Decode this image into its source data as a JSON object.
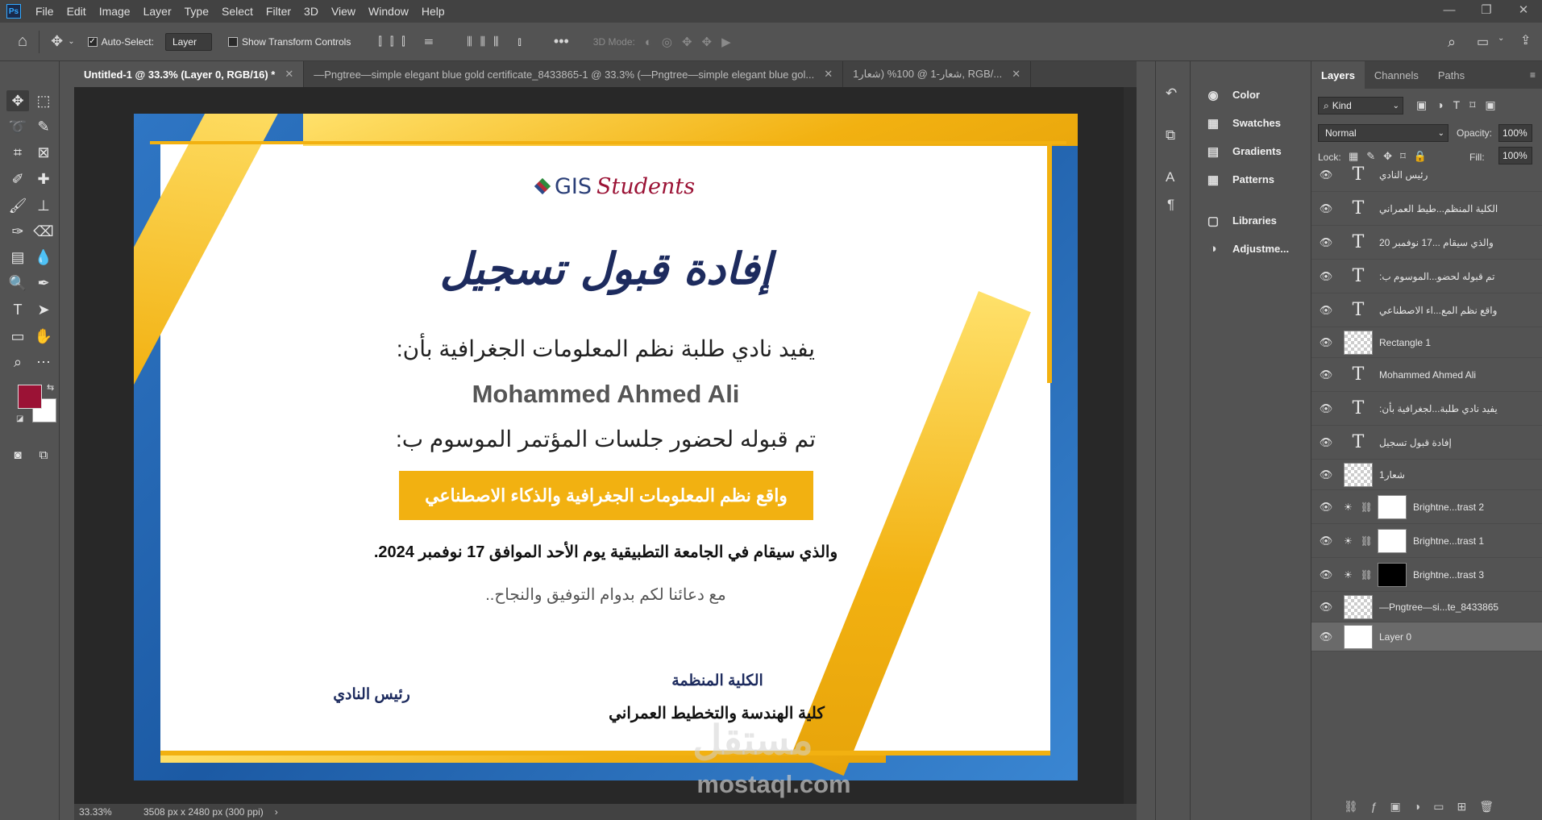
{
  "menubar": {
    "logo": "Ps",
    "items": [
      "File",
      "Edit",
      "Image",
      "Layer",
      "Type",
      "Select",
      "Filter",
      "3D",
      "View",
      "Window",
      "Help"
    ],
    "window_controls": [
      "—",
      "❐",
      "✕"
    ]
  },
  "options": {
    "auto_select_label": "Auto-Select:",
    "auto_select_value": "Layer",
    "transform_label": "Show Transform Controls",
    "mode_3d_label": "3D Mode:"
  },
  "tabs": [
    {
      "label": "Untitled-1 @ 33.3% (Layer 0, RGB/16) *",
      "active": true
    },
    {
      "label": "—Pngtree—simple elegant blue gold certificate_8433865-1 @ 33.3% (—Pngtree—simple elegant blue gol...",
      "active": false
    },
    {
      "label": "شعار-1 @ 100% (شعار1, RGB/...",
      "active": false
    }
  ],
  "status": {
    "zoom": "33.33%",
    "doc_size": "3508 px x 2480 px (300 ppi)"
  },
  "certificate": {
    "logo_text_a": "GIS",
    "logo_text_b": "Students",
    "title": "إفادة قبول تسجيل",
    "line1": "يفيد نادي طلبة نظم المعلومات الجغرافية بأن:",
    "name": "Mohammed Ahmed Ali",
    "line2": "تم قبوله لحضور جلسات المؤتمر الموسوم ب:",
    "conference": "واقع نظم المعلومات الجغرافية والذكاء الاصطناعي",
    "line3": "والذي سيقام في الجامعة التطبيقية يوم الأحد الموافق 17 نوفمبر 2024.",
    "line4": "مع دعائنا لكم بدوام التوفيق والنجاح..",
    "sig_right_title": "الكلية المنظمة",
    "sig_right_name": "كلية الهندسة والتخطيط العمراني",
    "sig_left_title": "رئيس النادي",
    "watermark_ar": "مستقل",
    "watermark_en": "mostaql.com",
    "colors": {
      "gold": "#f2b111",
      "blue": "#2f76c4",
      "navy": "#1d2b5e"
    }
  },
  "properties_panel": [
    {
      "label": "Color",
      "icon": "color-icon"
    },
    {
      "label": "Swatches",
      "icon": "swatches-icon"
    },
    {
      "label": "Gradients",
      "icon": "gradients-icon"
    },
    {
      "label": "Patterns",
      "icon": "patterns-icon"
    },
    {
      "label": "Libraries",
      "icon": "libraries-icon"
    },
    {
      "label": "Adjustme...",
      "icon": "adjustments-icon"
    }
  ],
  "layers_panel": {
    "tabs": [
      "Layers",
      "Channels",
      "Paths"
    ],
    "kind_label": "Kind",
    "blend_mode": "Normal",
    "opacity_label": "Opacity:",
    "opacity_value": "100%",
    "lock_label": "Lock:",
    "fill_label": "Fill:",
    "fill_value": "100%",
    "layers": [
      {
        "name": "رئيس النادي",
        "kind": "text"
      },
      {
        "name": "الكلية المنظم...طيط العمراني",
        "kind": "text"
      },
      {
        "name": "والذي سيقام ...17 نوفمبر 20",
        "kind": "text"
      },
      {
        "name": "تم قبوله لحضو...الموسوم ب:",
        "kind": "text"
      },
      {
        "name": "واقع نظم المع...اء الاصطناعي",
        "kind": "text"
      },
      {
        "name": "Rectangle 1",
        "kind": "shape"
      },
      {
        "name": "Mohammed Ahmed Ali",
        "kind": "text"
      },
      {
        "name": "يفيد نادي طلبة...لجغرافية بأن:",
        "kind": "text"
      },
      {
        "name": "إفادة قبول تسجيل",
        "kind": "text"
      },
      {
        "name": "شعار1",
        "kind": "smart"
      },
      {
        "name": "Brightne...trast 2",
        "kind": "adjust"
      },
      {
        "name": "Brightne...trast 1",
        "kind": "adjust"
      },
      {
        "name": "Brightne...trast 3",
        "kind": "adjust-black"
      },
      {
        "name": "—Pngtree—si...te_8433865",
        "kind": "smart"
      },
      {
        "name": "Layer 0",
        "kind": "pixel"
      }
    ]
  }
}
